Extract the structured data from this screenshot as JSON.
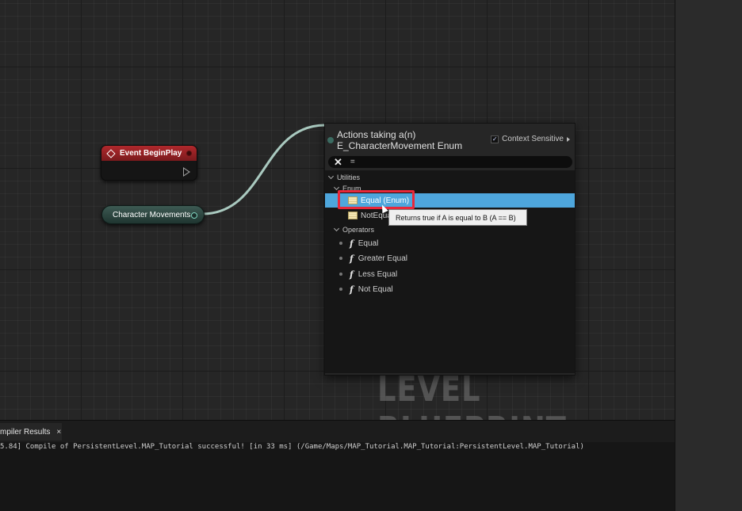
{
  "graph": {
    "event_node": {
      "label": "Event BeginPlay",
      "color": "#b0282c"
    },
    "variable_node": {
      "label": "Character Movements",
      "color": "#3d5a53"
    },
    "watermark": "LEVEL BLUEPRINT"
  },
  "action_menu": {
    "title_line1": "Actions taking a(n)",
    "title_line2": "E_CharacterMovement Enum",
    "context_sensitive_label": "Context Sensitive",
    "context_sensitive_checked": true,
    "search_value": "=",
    "categories": {
      "utilities": "Utilities",
      "enum": "Enum",
      "operators": "Operators"
    },
    "enum_items": [
      "Equal (Enum)",
      "NotEqual"
    ],
    "operator_items": [
      "Equal",
      "Greater Equal",
      "Less Equal",
      "Not Equal"
    ],
    "selected_item": "Equal (Enum)",
    "selection_color": "#4ea6dc",
    "tooltip": "Returns true if A is equal to B (A == B)"
  },
  "bottom_panel": {
    "tab_label": "mpiler Results",
    "tab_close": "×",
    "log_line": "5.84] Compile of PersistentLevel.MAP_Tutorial successful! [in 33 ms] (/Game/Maps/MAP_Tutorial.MAP_Tutorial:PersistentLevel.MAP_Tutorial)"
  },
  "icons": {
    "event": "event-diamond-icon",
    "enum": "enum-icon",
    "function": "function-icon",
    "clear": "clear-x-icon"
  }
}
